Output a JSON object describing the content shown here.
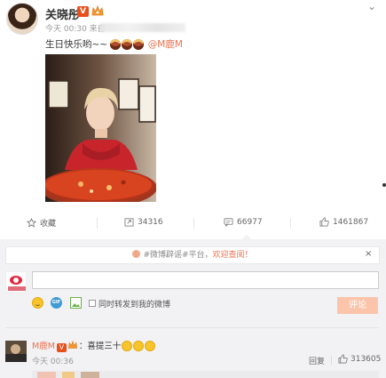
{
  "post": {
    "author": "关晓彤",
    "verified_badge": "V",
    "meta_time": "今天 00:30 来自",
    "text_before": "生日快乐哟~~",
    "mention": "@M鹿M",
    "more_icon": "chevron-down-icon"
  },
  "actions": {
    "favorite_label": "收藏",
    "repost_count": "34316",
    "comment_count": "66977",
    "like_count": "1461867"
  },
  "comments": {
    "notice_prefix": "#微博辟谣#平台，",
    "notice_link": "欢迎查阅！",
    "notice_close": "×",
    "also_repost_label": "同时转发到我的微博",
    "submit_label": "评论",
    "items": [
      {
        "user": "M鹿M",
        "verified_badge": "V",
        "text": "：喜提三十",
        "time": "今天 00:36",
        "reply_label": "回复",
        "likes": "313605"
      }
    ]
  },
  "colors": {
    "accent": "#eb7350",
    "verified": "#e8501b",
    "panel_bg": "#f2f2f5"
  }
}
